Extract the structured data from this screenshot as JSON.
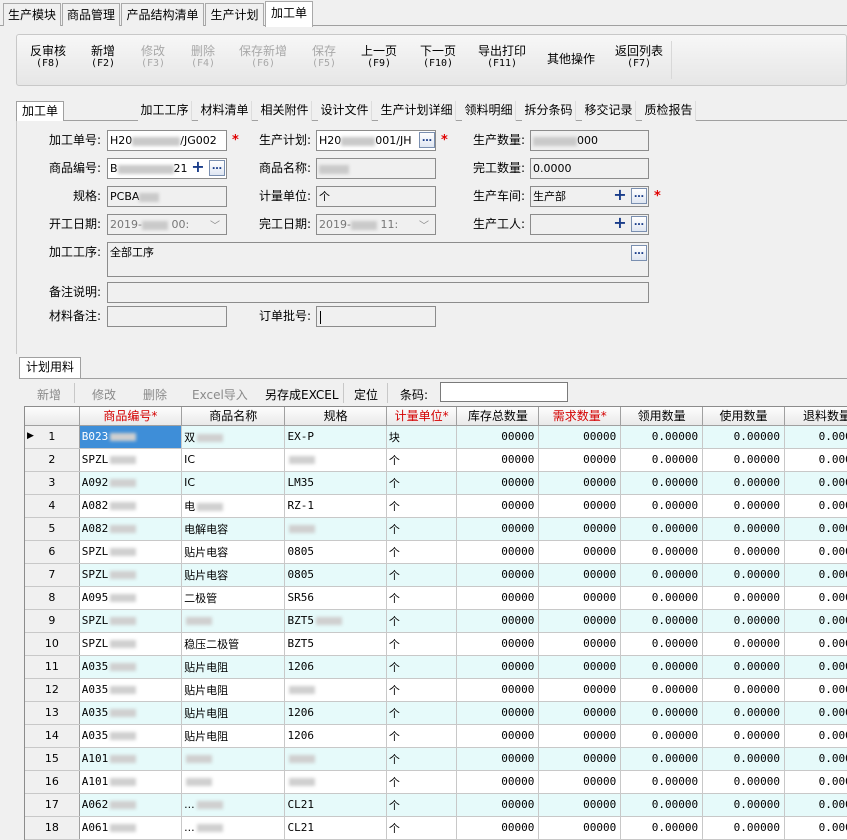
{
  "module_tabs": [
    "生产模块",
    "商品管理",
    "产品结构清单",
    "生产计划",
    "加工单"
  ],
  "toolbar": [
    {
      "label": "反审核",
      "key": "(F8)",
      "enabled": true
    },
    {
      "label": "新增",
      "key": "(F2)",
      "enabled": true
    },
    {
      "label": "修改",
      "key": "(F3)",
      "enabled": false
    },
    {
      "label": "删除",
      "key": "(F4)",
      "enabled": false
    },
    {
      "label": "保存新增",
      "key": "(F6)",
      "enabled": false
    },
    {
      "label": "保存",
      "key": "(F5)",
      "enabled": false
    },
    {
      "label": "上一页",
      "key": "(F9)",
      "enabled": true
    },
    {
      "label": "下一页",
      "key": "(F10)",
      "enabled": true
    },
    {
      "label": "导出打印",
      "key": "(F11)",
      "enabled": true
    },
    {
      "label": "其他操作",
      "key": "",
      "enabled": true
    },
    {
      "label": "返回列表",
      "key": "(F7)",
      "enabled": true
    }
  ],
  "doc_tabs": [
    "加工单",
    "加工工序",
    "材料清单",
    "相关附件",
    "设计文件",
    "生产计划详细",
    "领料明细",
    "拆分条码",
    "移交记录",
    "质检报告"
  ],
  "form": {
    "order_no_label": "加工单号:",
    "order_no_value": "/JG002",
    "order_no_prefix": "H20",
    "plan_label": "生产计划:",
    "plan_value": "001/JH",
    "plan_prefix": "H20",
    "qty_label": "生产数量:",
    "qty_value": "000",
    "product_code_label": "商品编号:",
    "product_code_value": "21",
    "product_code_prefix": "B",
    "product_name_label": "商品名称:",
    "done_qty_label": "完工数量:",
    "done_qty_value": "0.0000",
    "spec_label": "规格:",
    "spec_value": "PCBA",
    "unit_label": "计量单位:",
    "unit_value": "个",
    "workshop_label": "生产车间:",
    "workshop_value": "生产部",
    "start_label": "开工日期:",
    "start_value": "2019-",
    "start_time": "00:",
    "end_label": "完工日期:",
    "end_value": "2019-",
    "end_time": "11:",
    "worker_label": "生产工人:",
    "process_label": "加工工序:",
    "process_value": "全部工序",
    "remark_label": "备注说明:",
    "material_remark_label": "材料备注:",
    "batch_label": "订单批号:"
  },
  "plan": {
    "tab_label": "计划用料",
    "buttons": [
      "新增",
      "修改",
      "删除",
      "Excel导入",
      "另存成EXCEL",
      "定位"
    ],
    "barcode_label": "条码:"
  },
  "grid": {
    "columns": [
      "商品编号*",
      "商品名称",
      "规格",
      "计量单位*",
      "库存总数量",
      "需求数量*",
      "领用数量",
      "使用数量",
      "退料数量"
    ],
    "rows": [
      [
        "B023",
        "双",
        "EX-P",
        "块",
        "00000",
        "00000",
        "0.00000",
        "0.00000",
        "0.00000"
      ],
      [
        "SPZL",
        "IC",
        "",
        "个",
        "00000",
        "00000",
        "0.00000",
        "0.00000",
        "0.00000"
      ],
      [
        "A092",
        "IC",
        "LM35",
        "个",
        "00000",
        "00000",
        "0.00000",
        "0.00000",
        "0.00000"
      ],
      [
        "A082",
        "电",
        "RZ-1",
        "个",
        "00000",
        "00000",
        "0.00000",
        "0.00000",
        "0.00000"
      ],
      [
        "A082",
        "电解电容",
        "",
        "个",
        "00000",
        "00000",
        "0.00000",
        "0.00000",
        "0.00000"
      ],
      [
        "SPZL",
        "贴片电容",
        "0805",
        "个",
        "00000",
        "00000",
        "0.00000",
        "0.00000",
        "0.00000"
      ],
      [
        "SPZL",
        "贴片电容",
        "0805",
        "个",
        "00000",
        "00000",
        "0.00000",
        "0.00000",
        "0.00000"
      ],
      [
        "A095",
        "二极管",
        "SR56",
        "个",
        "00000",
        "00000",
        "0.00000",
        "0.00000",
        "0.00000"
      ],
      [
        "SPZL",
        "",
        "BZT5",
        "个",
        "00000",
        "00000",
        "0.00000",
        "0.00000",
        "0.00000"
      ],
      [
        "SPZL",
        "稳压二极管",
        "BZT5",
        "个",
        "00000",
        "00000",
        "0.00000",
        "0.00000",
        "0.00000"
      ],
      [
        "A035",
        "贴片电阻",
        "1206",
        "个",
        "00000",
        "00000",
        "0.00000",
        "0.00000",
        "0.00000"
      ],
      [
        "A035",
        "贴片电阻",
        "",
        "个",
        "00000",
        "00000",
        "0.00000",
        "0.00000",
        "0.00000"
      ],
      [
        "A035",
        "贴片电阻",
        "1206",
        "个",
        "00000",
        "00000",
        "0.00000",
        "0.00000",
        "0.00000"
      ],
      [
        "A035",
        "贴片电阻",
        "1206",
        "个",
        "00000",
        "00000",
        "0.00000",
        "0.00000",
        "0.00000"
      ],
      [
        "A101",
        "",
        "",
        "个",
        "00000",
        "00000",
        "0.00000",
        "0.00000",
        "0.00000"
      ],
      [
        "A101",
        "",
        "",
        "个",
        "00000",
        "00000",
        "0.00000",
        "0.00000",
        "0.00000"
      ],
      [
        "A062",
        "...",
        "CL21",
        "个",
        "00000",
        "00000",
        "0.00000",
        "0.00000",
        "0.00000"
      ],
      [
        "A061",
        "...",
        "CL21",
        "个",
        "00000",
        "00000",
        "0.00000",
        "0.00000",
        "0.00000"
      ]
    ]
  }
}
